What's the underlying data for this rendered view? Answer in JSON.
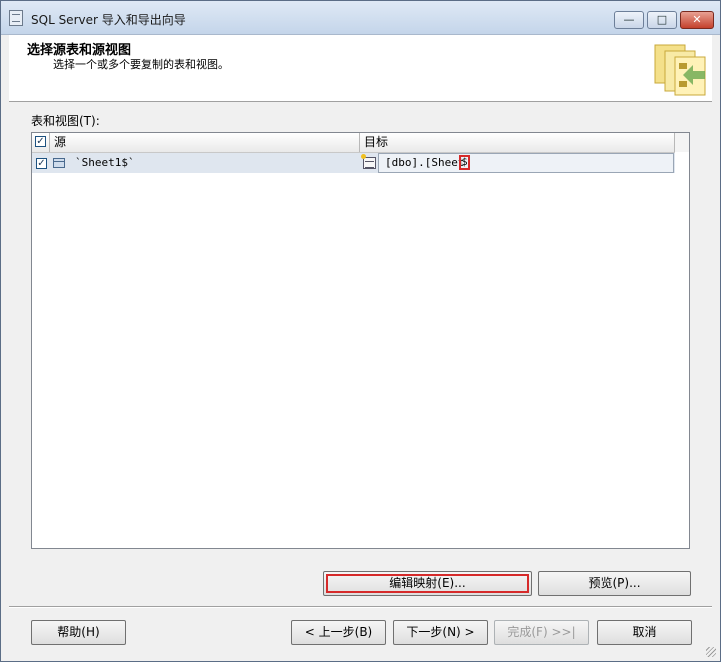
{
  "window": {
    "title": "SQL Server 导入和导出向导",
    "controls": {
      "minimize": "—",
      "maximize": "□",
      "close": "✕"
    }
  },
  "header": {
    "title": "选择源表和源视图",
    "subtitle": "选择一个或多个要复制的表和视图。"
  },
  "tables_label": "表和视图(T):",
  "grid": {
    "columns": {
      "source": "源",
      "target": "目标"
    },
    "rows": [
      {
        "checked": true,
        "source": "`Sheet1$`",
        "target": "[dbo].[Sheet",
        "target_suffix": "$"
      }
    ]
  },
  "buttons": {
    "edit_mapping": "编辑映射(E)...",
    "preview": "预览(P)...",
    "help": "帮助(H)",
    "back": "< 上一步(B)",
    "next": "下一步(N) >",
    "finish": "完成(F) >>|",
    "cancel": "取消"
  },
  "colors": {
    "highlight_outline": "#d62a2a",
    "selected_row": "#dfe6ef"
  }
}
